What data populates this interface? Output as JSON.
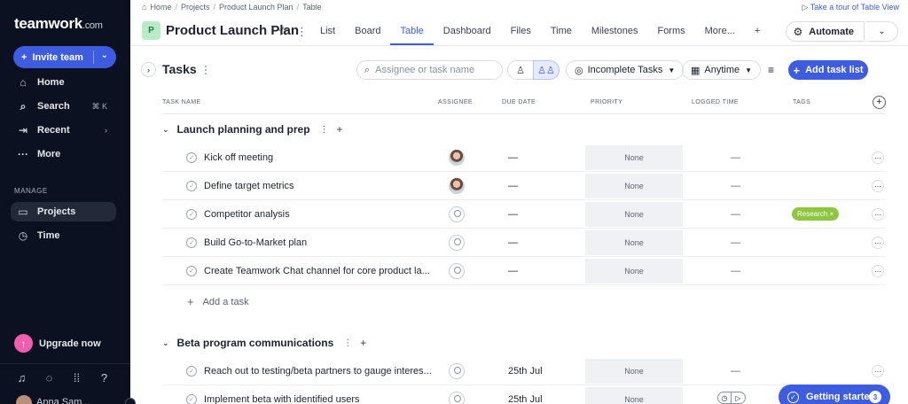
{
  "sidebar": {
    "logo_text": "teamwork",
    "logo_suffix": ".com",
    "invite_label": "Invite team",
    "nav": [
      {
        "label": "Home",
        "icon": "home-icon"
      },
      {
        "label": "Search",
        "icon": "search-icon",
        "shortcut": "⌘ K"
      },
      {
        "label": "Recent",
        "icon": "recent-icon"
      },
      {
        "label": "More",
        "icon": "more-icon"
      }
    ],
    "manage_label": "MANAGE",
    "manage_items": [
      {
        "label": "Projects",
        "icon": "folder-icon"
      },
      {
        "label": "Time",
        "icon": "clock-icon"
      }
    ],
    "upgrade_label": "Upgrade now",
    "user_name": "Anna Sam..."
  },
  "header": {
    "breadcrumb": [
      "Home",
      "Projects",
      "Product Launch Plan",
      "Table"
    ],
    "tour_link": "Take a tour of Table View",
    "project_badge": "P",
    "project_title": "Product Launch Plan",
    "tabs": [
      "List",
      "Board",
      "Table",
      "Dashboard",
      "Files",
      "Time",
      "Milestones",
      "Forms",
      "More...",
      "+"
    ],
    "active_tab": "Table",
    "automate_label": "Automate"
  },
  "toolbar": {
    "title": "Tasks",
    "search_placeholder": "Assignee or task name",
    "filter_label": "Incomplete Tasks",
    "date_label": "Anytime",
    "add_list_label": "Add task list"
  },
  "columns": [
    "TASK NAME",
    "ASSIGNEE",
    "DUE DATE",
    "PRIORITY",
    "LOGGED TIME",
    "TAGS"
  ],
  "groups": [
    {
      "title": "Launch planning and prep",
      "tasks": [
        {
          "name": "Kick off meeting",
          "assignee": "photo",
          "due": "—",
          "priority": "None",
          "logged": "—",
          "tag": ""
        },
        {
          "name": "Define target metrics",
          "assignee": "photo",
          "due": "—",
          "priority": "None",
          "logged": "—",
          "tag": ""
        },
        {
          "name": "Competitor analysis",
          "assignee": "empty",
          "due": "—",
          "priority": "None",
          "logged": "—",
          "tag": "Research ×"
        },
        {
          "name": "Build Go-to-Market plan",
          "assignee": "empty",
          "due": "—",
          "priority": "None",
          "logged": "—",
          "tag": ""
        },
        {
          "name": "Create Teamwork Chat channel for core product la...",
          "assignee": "empty",
          "due": "—",
          "priority": "None",
          "logged": "—",
          "tag": ""
        }
      ],
      "add_task_label": "Add a task"
    },
    {
      "title": "Beta program communications",
      "tasks": [
        {
          "name": "Reach out to testing/beta partners to gauge interes...",
          "assignee": "empty",
          "due": "25th Jul",
          "priority": "None",
          "logged": "—",
          "tag": ""
        },
        {
          "name": "Implement beta with identified users",
          "assignee": "empty",
          "due": "25th Jul",
          "priority": "None",
          "logged": "",
          "tag": ""
        }
      ]
    }
  ],
  "getting_started": {
    "label": "Getting started",
    "count": "3"
  }
}
